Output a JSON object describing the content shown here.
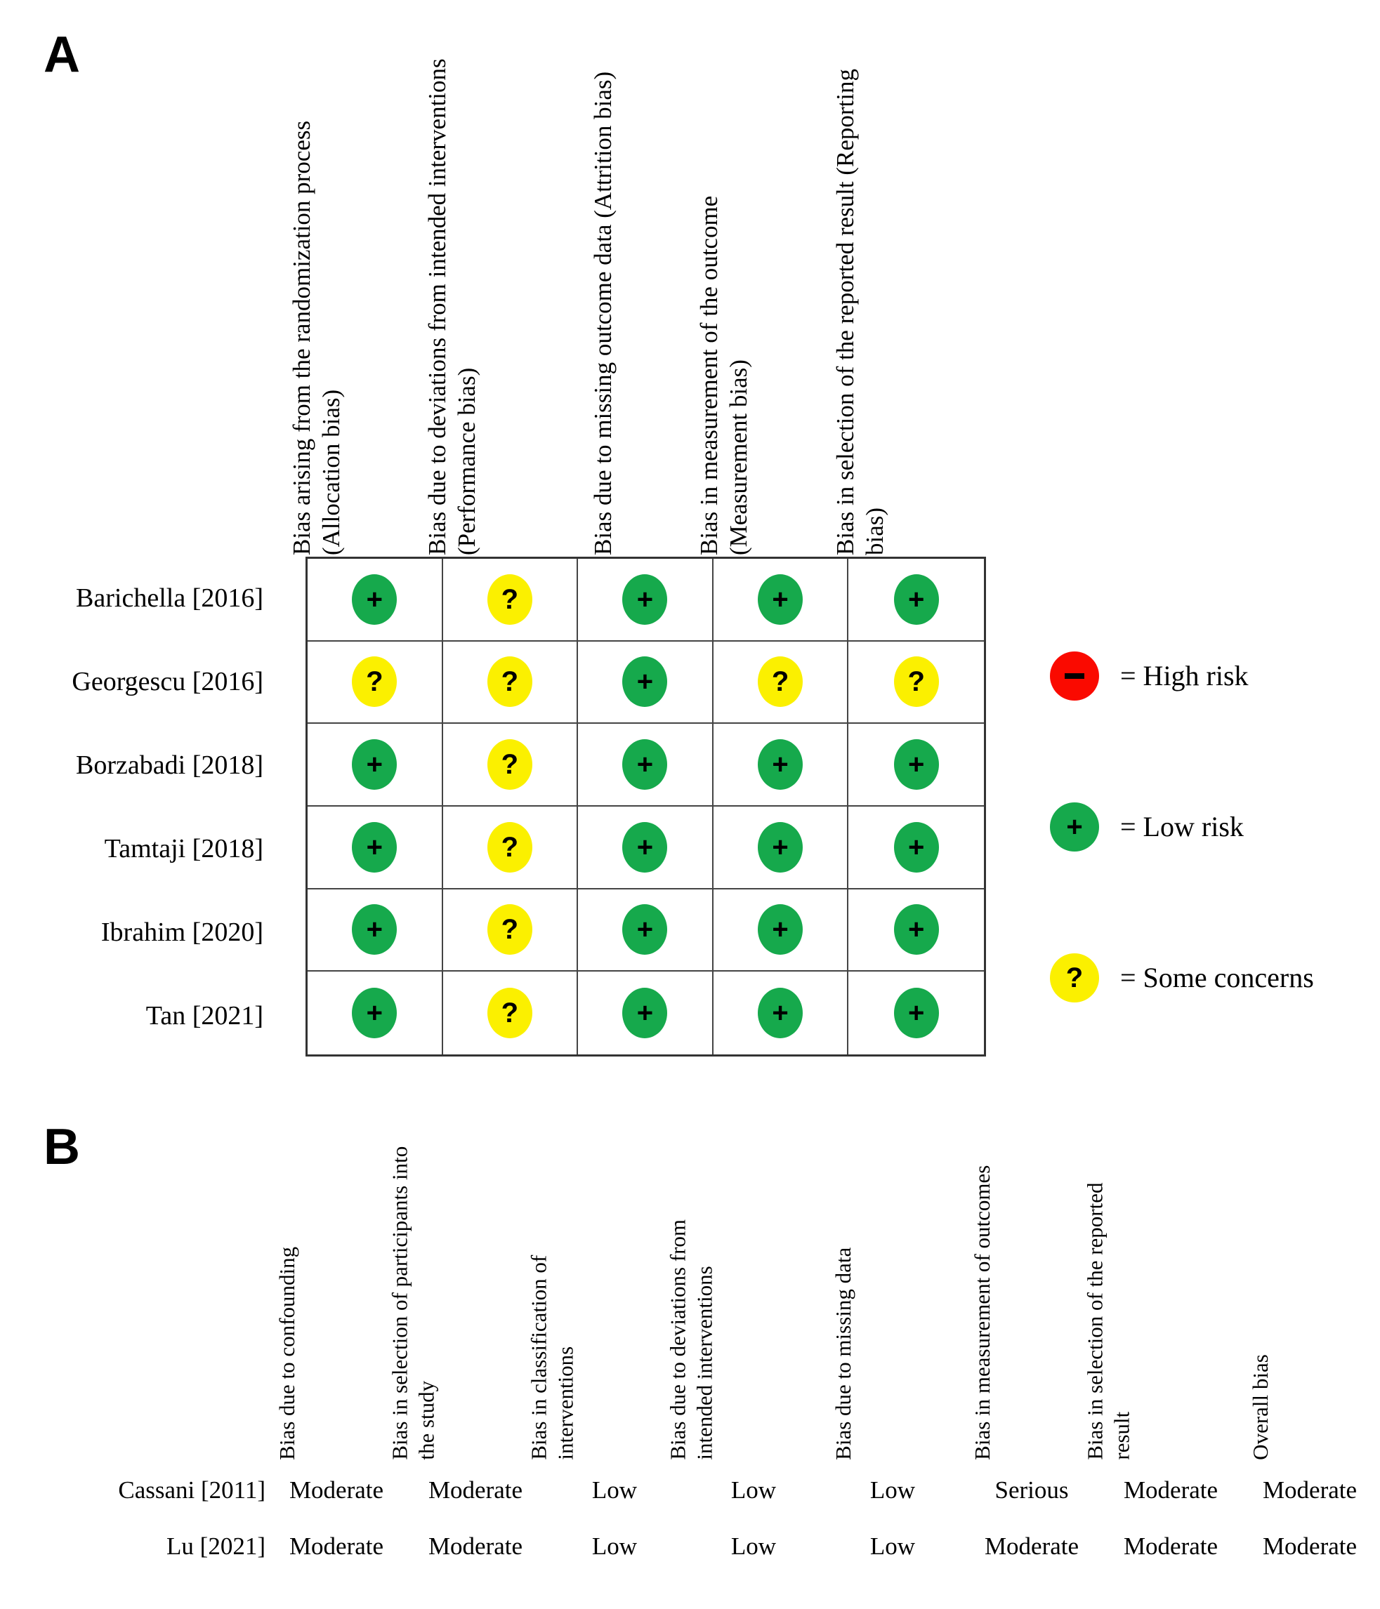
{
  "panels": {
    "a_label": "A",
    "b_label": "B"
  },
  "panel_a": {
    "columns": [
      "Bias arising from the randomization process (Allocation bias)",
      "Bias due to deviations from intended interventions (Performance bias)",
      "Bias due to missing outcome data (Attrition bias)",
      "Bias in measurement of the outcome (Measurement bias)",
      "Bias in selection of the reported result (Reporting bias)"
    ],
    "studies": [
      "Barichella [2016]",
      "Georgescu [2016]",
      "Borzabadi [2018]",
      "Tamtaji [2018]",
      "Ibrahim [2020]",
      "Tan [2021]"
    ],
    "judgements": [
      [
        "low",
        "some",
        "low",
        "low",
        "low"
      ],
      [
        "some",
        "some",
        "low",
        "some",
        "some"
      ],
      [
        "low",
        "some",
        "low",
        "low",
        "low"
      ],
      [
        "low",
        "some",
        "low",
        "low",
        "low"
      ],
      [
        "low",
        "some",
        "low",
        "low",
        "low"
      ],
      [
        "low",
        "some",
        "low",
        "low",
        "low"
      ]
    ],
    "symbols": {
      "low": "+",
      "some": "?",
      "high": "−"
    },
    "colors": {
      "low": "#16a94c",
      "some": "#fbf000",
      "high": "#fa0a00",
      "grid_line": "#444444",
      "grid_border": "#333333"
    }
  },
  "legend": {
    "items": [
      {
        "risk": "high",
        "symbol": "−",
        "label": "= High risk",
        "color": "#fa0a00"
      },
      {
        "risk": "low",
        "symbol": "+",
        "label": "= Low risk",
        "color": "#16a94c"
      },
      {
        "risk": "some",
        "symbol": "?",
        "label": "= Some concerns",
        "color": "#fbf000"
      }
    ]
  },
  "panel_b": {
    "columns": [
      "Bias due to confounding",
      "Bias in selection of participants into the study",
      "Bias in classification of interventions",
      "Bias due to deviations from intended interventions",
      "Bias due to missing data",
      "Bias in measurement of outcomes",
      "Bias in selection of the reported result",
      "Overall bias"
    ],
    "rows": [
      {
        "study": "Cassani [2011]",
        "values": [
          "Moderate",
          "Moderate",
          "Low",
          "Low",
          "Low",
          "Serious",
          "Moderate",
          "Moderate"
        ]
      },
      {
        "study": "Lu [2021]",
        "values": [
          "Moderate",
          "Moderate",
          "Low",
          "Low",
          "Low",
          "Moderate",
          "Moderate",
          "Moderate"
        ]
      }
    ]
  }
}
